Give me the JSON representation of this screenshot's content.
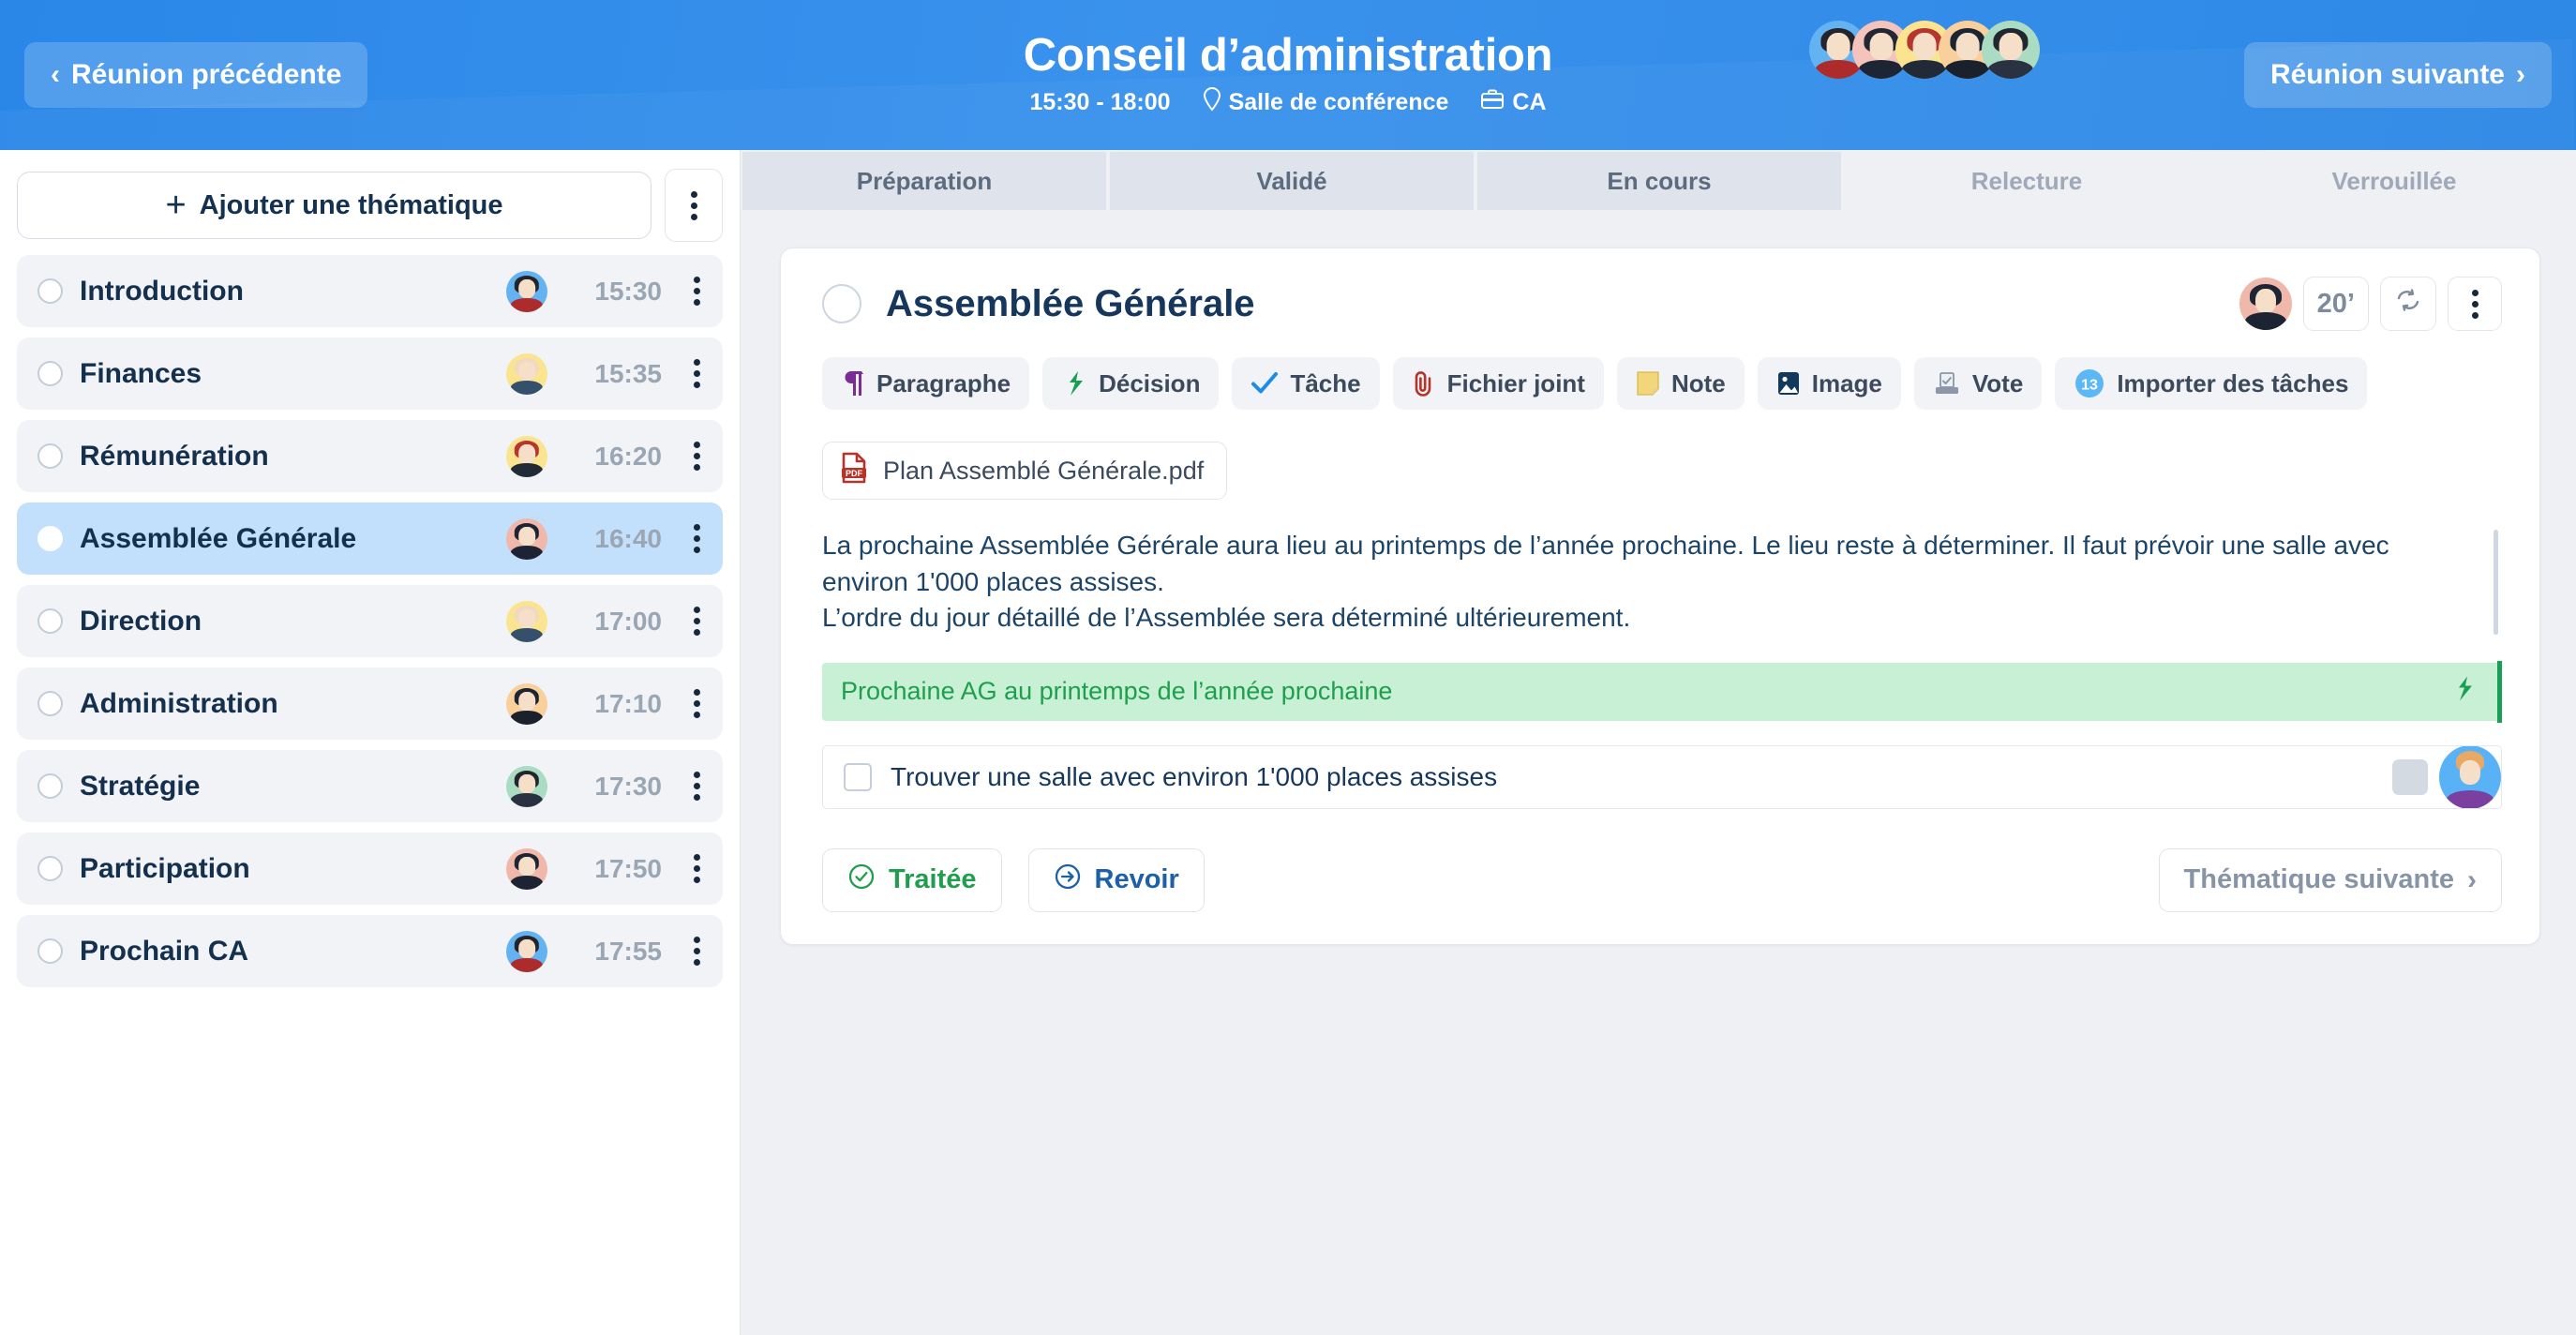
{
  "header": {
    "prev_button": "Réunion précédente",
    "next_button": "Réunion suivante",
    "title": "Conseil d’administration",
    "time_range": "15:30 - 18:00",
    "location": "Salle de conférence",
    "org": "CA",
    "location_icon": "map-pin-icon",
    "org_icon": "briefcase-icon",
    "prev_icon": "chevron-left-icon",
    "next_icon": "chevron-right-icon",
    "participants": [
      {
        "name": "participant-1",
        "bg": "#63b3f2",
        "hair": "#23242c",
        "skin": "#f6dfc8",
        "shirt": "#ad2b2b",
        "style": "long"
      },
      {
        "name": "participant-2",
        "bg": "#f4c3bc",
        "hair": "#232733",
        "skin": "#f6dfc8",
        "shirt": "#1d2433",
        "style": "beard"
      },
      {
        "name": "participant-3",
        "bg": "#fbe48f",
        "hair": "#b6352e",
        "skin": "#f6dfc8",
        "shirt": "#222a38",
        "style": "long"
      },
      {
        "name": "participant-4",
        "bg": "#f9cf9b",
        "hair": "#1d2433",
        "skin": "#f6dfc8",
        "shirt": "#1a202c",
        "style": "short"
      },
      {
        "name": "participant-5",
        "bg": "#a9dcc2",
        "hair": "#22272f",
        "skin": "#f6dfc8",
        "shirt": "#2a3242",
        "style": "short"
      }
    ]
  },
  "sidebar": {
    "add_button": "Ajouter une thématique",
    "add_icon": "plus-icon",
    "menu_icon": "kebab-menu-icon",
    "topics": [
      {
        "label": "Introduction",
        "time": "15:30",
        "active": false,
        "bg": "#63b3f2",
        "hair": "#23242c",
        "shirt": "#ad2b2b"
      },
      {
        "label": "Finances",
        "time": "15:35",
        "active": false,
        "bg": "#fbe48f",
        "hair": "#f0d9bf",
        "shirt": "#34506b"
      },
      {
        "label": "Rémunération",
        "time": "16:20",
        "active": false,
        "bg": "#fbe48f",
        "hair": "#b6352e",
        "shirt": "#222a38"
      },
      {
        "label": "Assemblée Générale",
        "time": "16:40",
        "active": true,
        "bg": "#f0b7ab",
        "hair": "#1d2433",
        "shirt": "#1c2433"
      },
      {
        "label": "Direction",
        "time": "17:00",
        "active": false,
        "bg": "#fbe48f",
        "hair": "#f0d9bf",
        "shirt": "#34506b"
      },
      {
        "label": "Administration",
        "time": "17:10",
        "active": false,
        "bg": "#f9cf9b",
        "hair": "#1d2433",
        "shirt": "#1a202c"
      },
      {
        "label": "Stratégie",
        "time": "17:30",
        "active": false,
        "bg": "#a9dcc2",
        "hair": "#22272f",
        "shirt": "#2a3242"
      },
      {
        "label": "Participation",
        "time": "17:50",
        "active": false,
        "bg": "#f0b7ab",
        "hair": "#1d2433",
        "shirt": "#1c2433"
      },
      {
        "label": "Prochain CA",
        "time": "17:55",
        "active": false,
        "bg": "#63b3f2",
        "hair": "#23242c",
        "shirt": "#ad2b2b"
      }
    ]
  },
  "tabs": [
    {
      "label": "Préparation",
      "dim": false
    },
    {
      "label": "Validé",
      "dim": false
    },
    {
      "label": "En cours",
      "dim": false
    },
    {
      "label": "Relecture",
      "dim": true
    },
    {
      "label": "Verrouillée",
      "dim": true
    }
  ],
  "card": {
    "title": "Assemblée Générale",
    "duration": "20’",
    "refresh_icon": "refresh-icon",
    "menu_icon": "kebab-menu-icon",
    "owner_avatar": {
      "bg": "#f0b7ab",
      "hair": "#1d2433",
      "shirt": "#1c2433"
    },
    "toolbar": [
      {
        "label": "Paragraphe",
        "icon": "pilcrow-icon",
        "color": "#7b2d96"
      },
      {
        "label": "Décision",
        "icon": "decision-arrow-icon",
        "color": "#17a04f"
      },
      {
        "label": "Tâche",
        "icon": "check-icon",
        "color": "#1b8ce8"
      },
      {
        "label": "Fichier joint",
        "icon": "paperclip-icon",
        "color": "#b6332a"
      },
      {
        "label": "Note",
        "icon": "sticky-note-icon",
        "color": "#f2d67a"
      },
      {
        "label": "Image",
        "icon": "image-icon",
        "color": "#123a5c"
      },
      {
        "label": "Vote",
        "icon": "ballot-box-icon",
        "color": "#8b97a6"
      },
      {
        "label": "Importer des tâches",
        "icon": "badge-count-icon",
        "color": "#5bb8f5",
        "badge": "13"
      }
    ],
    "attachment": {
      "name": "Plan Assemblé Générale.pdf",
      "icon": "pdf-file-icon"
    },
    "paragraph_line1": "La prochaine Assemblée Gérérale aura lieu au printemps de l’année prochaine. Le lieu reste à déterminer. Il faut prévoir une salle avec environ 1'000 places assises.",
    "paragraph_line2": "L’ordre du jour détaillé de l’Assemblée sera déterminé ultérieurement.",
    "decision": {
      "text": "Prochaine AG au printemps de l’année prochaine",
      "icon": "decision-arrow-icon"
    },
    "task": {
      "text": "Trouver une salle avec environ 1'000 places assises",
      "checked": false,
      "avatar_bg": "#59b2f5"
    },
    "footer": {
      "done_label": "Traitée",
      "done_icon": "check-circle-icon",
      "review_label": "Revoir",
      "review_icon": "arrow-right-circle-icon",
      "next_label": "Thématique suivante",
      "next_icon": "chevron-right-icon"
    }
  }
}
